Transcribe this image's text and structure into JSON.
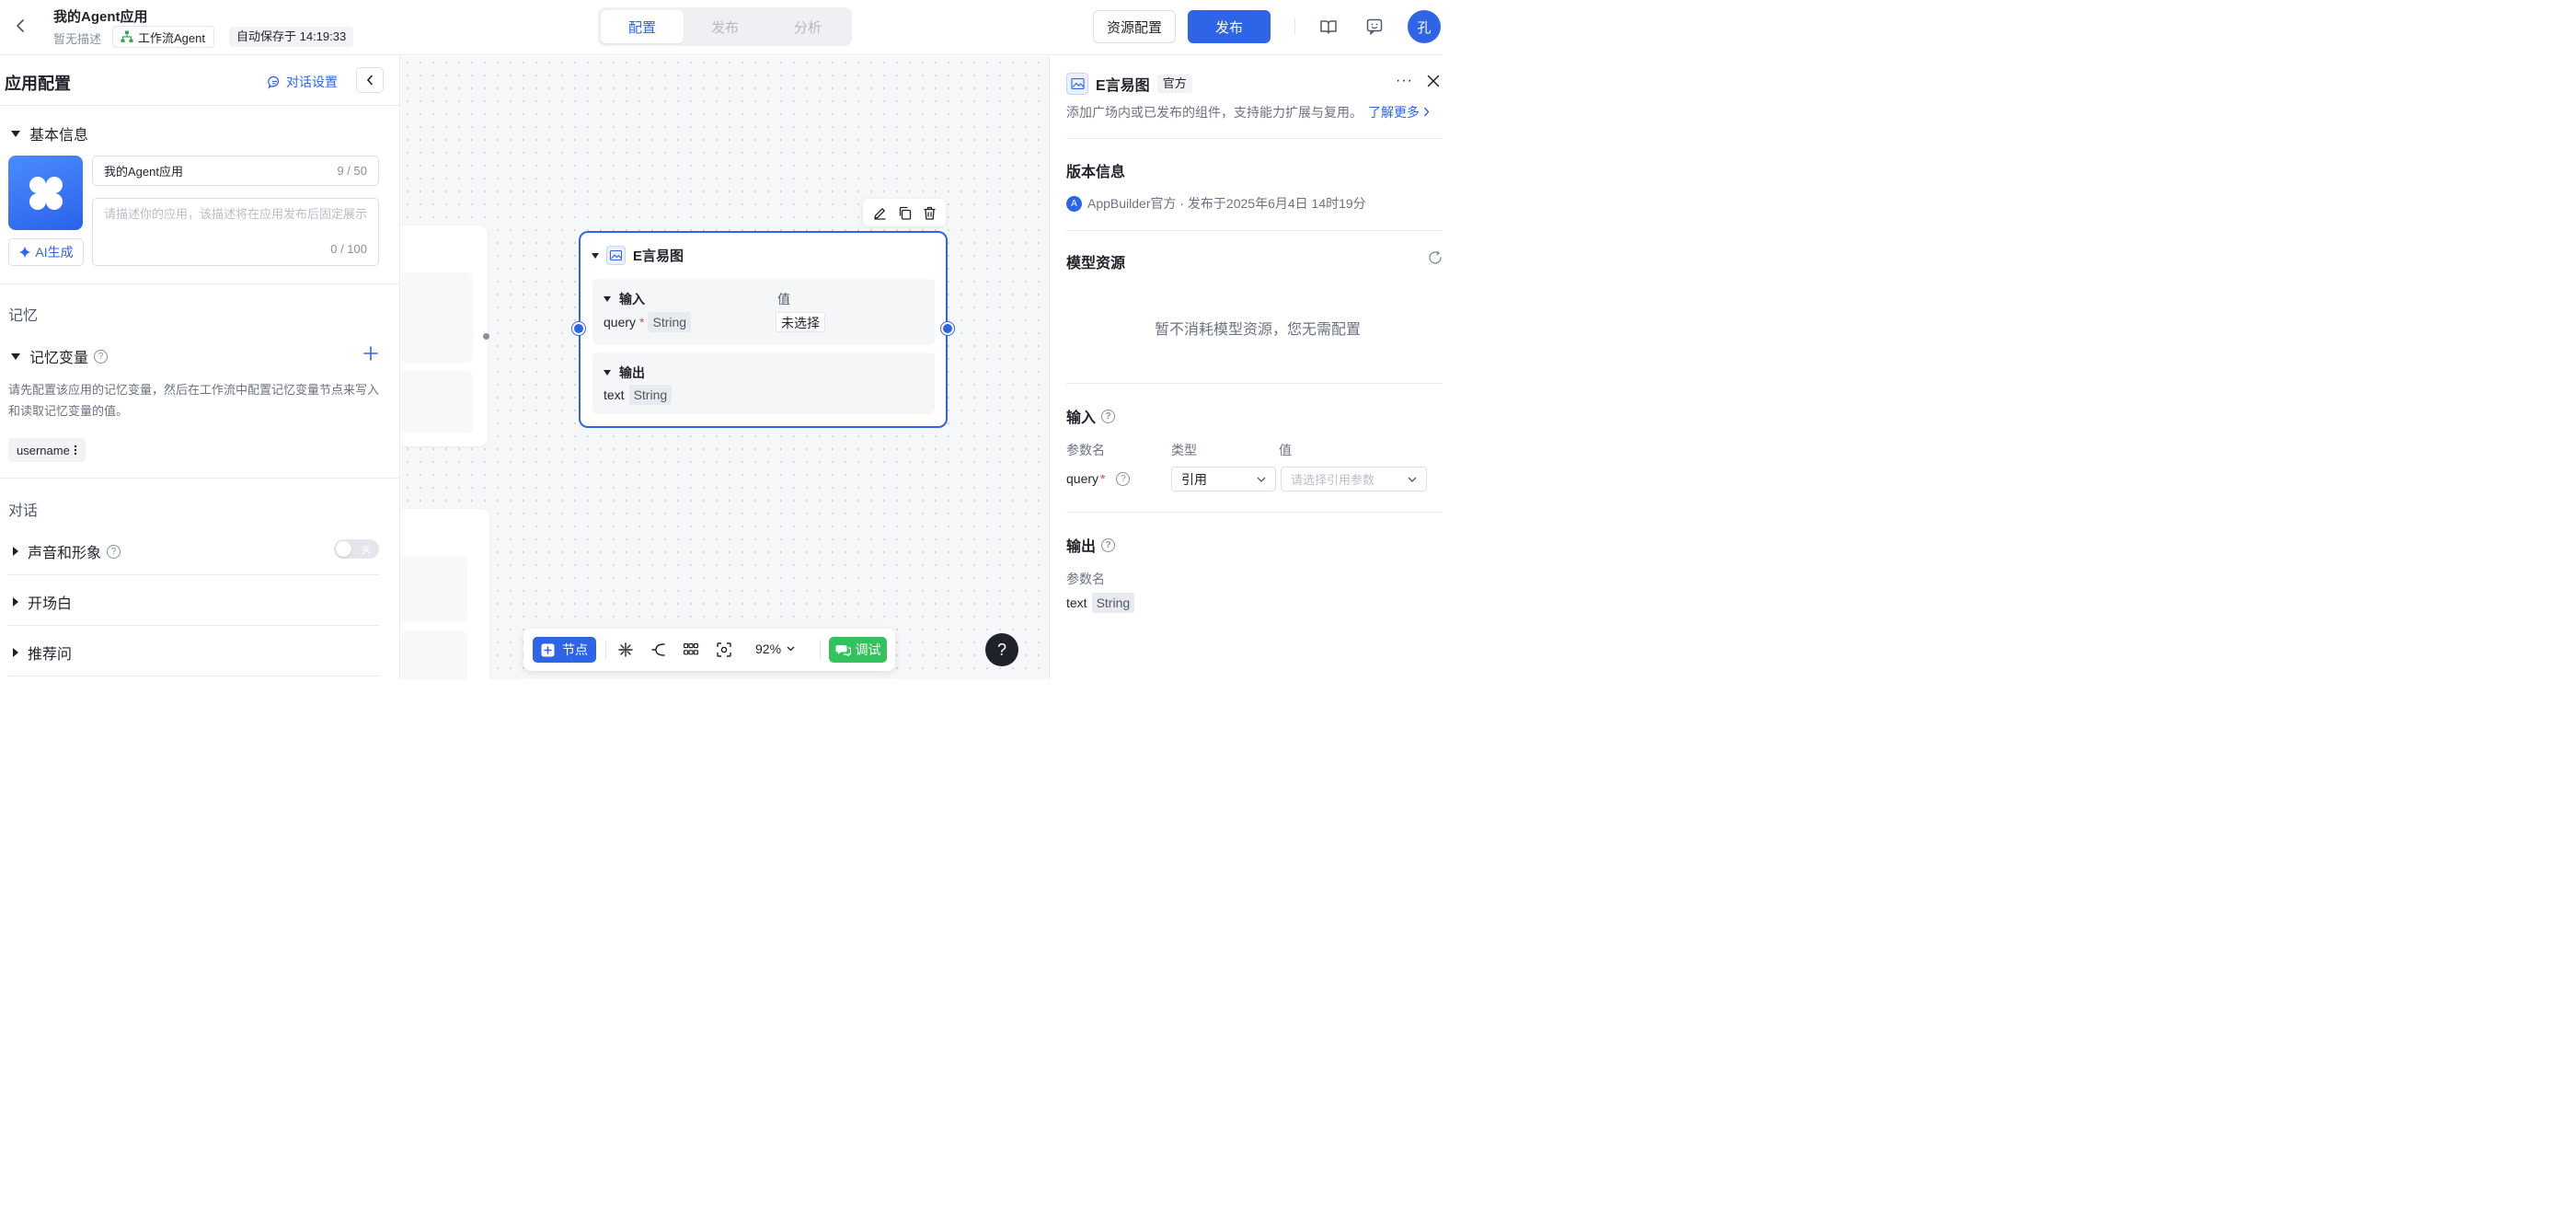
{
  "header": {
    "app_title": "我的Agent应用",
    "app_desc": "暂无描述",
    "app_type": "工作流Agent",
    "autosave": "自动保存于 14:19:33",
    "tabs": [
      {
        "label": "配置",
        "active": true
      },
      {
        "label": "发布",
        "active": false
      },
      {
        "label": "分析",
        "active": false
      }
    ],
    "resource_btn": "资源配置",
    "publish_btn": "发布",
    "avatar": "孔"
  },
  "left": {
    "title": "应用配置",
    "chat_settings": "对话设置",
    "basic_info": "基本信息",
    "name_value": "我的Agent应用",
    "name_count": "9 / 50",
    "desc_placeholder": "请描述你的应用，该描述将在应用发布后固定展示",
    "desc_count": "0 / 100",
    "ai_generate": "AI生成",
    "memory_group": "记忆",
    "memory_vars": "记忆变量",
    "memory_desc": "请先配置该应用的记忆变量，然后在工作流中配置记忆变量节点来写入和读取记忆变量的值。",
    "var_chip": "username",
    "dialog_group": "对话",
    "voice": "声音和形象",
    "voice_toggle": "关",
    "opening": "开场白",
    "suggest": "推荐问"
  },
  "node": {
    "title": "E言易图",
    "input_label": "输入",
    "value_label": "值",
    "param_name": "query",
    "required_mark": "*",
    "param_type": "String",
    "param_value": "未选择",
    "output_label": "输出",
    "out_name": "text",
    "out_type": "String"
  },
  "toolbar": {
    "node_btn": "节点",
    "zoom": "92%",
    "debug_btn": "调试",
    "help": "?"
  },
  "right": {
    "title": "E言易图",
    "official": "官方",
    "desc": "添加广场内或已发布的组件，支持能力扩展与复用。",
    "learn_more": "了解更多",
    "version_heading": "版本信息",
    "version_avatar": "A",
    "version_text": "AppBuilder官方 · 发布于2025年6月4日 14时19分",
    "model_heading": "模型资源",
    "model_empty": "暂不消耗模型资源，您无需配置",
    "input_heading": "输入",
    "col_param": "参数名",
    "col_type": "类型",
    "col_value": "值",
    "param_name": "query",
    "required_mark": "*",
    "type_value": "引用",
    "value_placeholder": "请选择引用参数",
    "output_heading": "输出",
    "out_col_param": "参数名",
    "out_name": "text",
    "out_type": "String"
  },
  "colors": {
    "primary": "#2e65e6",
    "debug_green": "#34c25f"
  }
}
